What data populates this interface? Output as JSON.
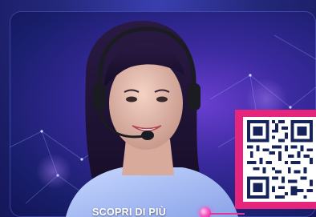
{
  "promo": {
    "cta_label": "SCOPRI DI PIÙ",
    "cta_dot_color": "#ff4fc0",
    "qr_frame_color": "#e5257b"
  },
  "icons": {
    "cta": "pink-dot-icon",
    "qr": "qr-code-icon"
  }
}
